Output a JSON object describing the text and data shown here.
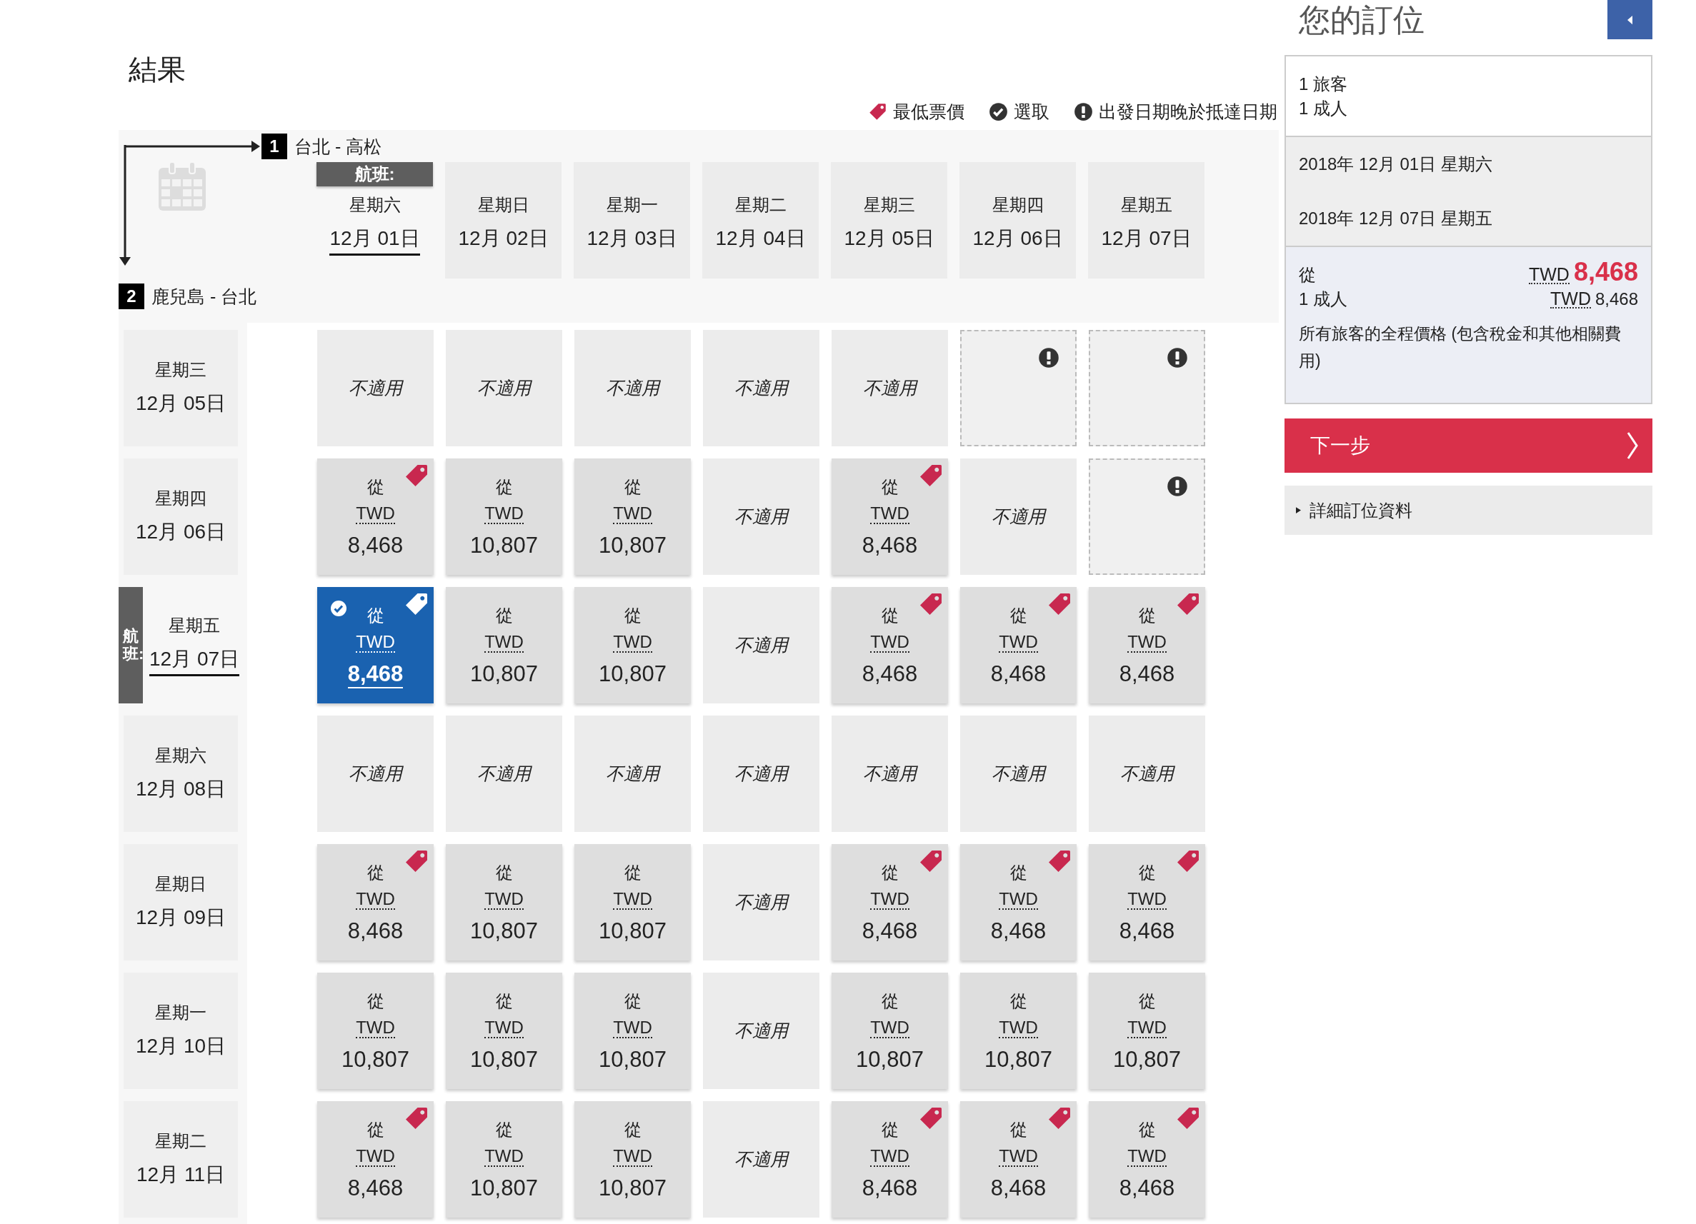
{
  "title": "結果",
  "legend": [
    {
      "kind": "lowest",
      "label": "最低票價"
    },
    {
      "kind": "selected",
      "label": "選取"
    },
    {
      "kind": "later",
      "label": "出發日期晚於抵達日期"
    }
  ],
  "routes": [
    {
      "number": "1",
      "label": "台北 - 高松"
    },
    {
      "number": "2",
      "label": "鹿兒島 - 台北"
    }
  ],
  "outbound_marker": "航班:",
  "return_marker": "航班:",
  "outbound_dates": [
    {
      "weekday": "星期六",
      "date": "12月 01日",
      "selected": true
    },
    {
      "weekday": "星期日",
      "date": "12月 02日",
      "selected": false
    },
    {
      "weekday": "星期一",
      "date": "12月 03日",
      "selected": false
    },
    {
      "weekday": "星期二",
      "date": "12月 04日",
      "selected": false
    },
    {
      "weekday": "星期三",
      "date": "12月 05日",
      "selected": false
    },
    {
      "weekday": "星期四",
      "date": "12月 06日",
      "selected": false
    },
    {
      "weekday": "星期五",
      "date": "12月 07日",
      "selected": false
    }
  ],
  "return_rows": [
    {
      "weekday": "星期三",
      "date": "12月 05日",
      "selected": false,
      "cells": [
        {
          "kind": "na",
          "text": "不適用"
        },
        {
          "kind": "na",
          "text": "不適用"
        },
        {
          "kind": "na",
          "text": "不適用"
        },
        {
          "kind": "na",
          "text": "不適用"
        },
        {
          "kind": "na",
          "text": "不適用"
        },
        {
          "kind": "later"
        },
        {
          "kind": "later"
        }
      ]
    },
    {
      "weekday": "星期四",
      "date": "12月 06日",
      "selected": false,
      "cells": [
        {
          "kind": "fare",
          "from": "從",
          "currency": "TWD",
          "amount": "8,468",
          "lowest": true,
          "selected": false
        },
        {
          "kind": "fare",
          "from": "從",
          "currency": "TWD",
          "amount": "10,807",
          "lowest": false,
          "selected": false
        },
        {
          "kind": "fare",
          "from": "從",
          "currency": "TWD",
          "amount": "10,807",
          "lowest": false,
          "selected": false
        },
        {
          "kind": "na",
          "text": "不適用"
        },
        {
          "kind": "fare",
          "from": "從",
          "currency": "TWD",
          "amount": "8,468",
          "lowest": true,
          "selected": false
        },
        {
          "kind": "na",
          "text": "不適用"
        },
        {
          "kind": "later"
        }
      ]
    },
    {
      "weekday": "星期五",
      "date": "12月 07日",
      "selected": true,
      "cells": [
        {
          "kind": "fare",
          "from": "從",
          "currency": "TWD",
          "amount": "8,468",
          "lowest": true,
          "selected": true
        },
        {
          "kind": "fare",
          "from": "從",
          "currency": "TWD",
          "amount": "10,807",
          "lowest": false,
          "selected": false
        },
        {
          "kind": "fare",
          "from": "從",
          "currency": "TWD",
          "amount": "10,807",
          "lowest": false,
          "selected": false
        },
        {
          "kind": "na",
          "text": "不適用"
        },
        {
          "kind": "fare",
          "from": "從",
          "currency": "TWD",
          "amount": "8,468",
          "lowest": true,
          "selected": false
        },
        {
          "kind": "fare",
          "from": "從",
          "currency": "TWD",
          "amount": "8,468",
          "lowest": true,
          "selected": false
        },
        {
          "kind": "fare",
          "from": "從",
          "currency": "TWD",
          "amount": "8,468",
          "lowest": true,
          "selected": false
        }
      ]
    },
    {
      "weekday": "星期六",
      "date": "12月 08日",
      "selected": false,
      "cells": [
        {
          "kind": "na",
          "text": "不適用"
        },
        {
          "kind": "na",
          "text": "不適用"
        },
        {
          "kind": "na",
          "text": "不適用"
        },
        {
          "kind": "na",
          "text": "不適用"
        },
        {
          "kind": "na",
          "text": "不適用"
        },
        {
          "kind": "na",
          "text": "不適用"
        },
        {
          "kind": "na",
          "text": "不適用"
        }
      ]
    },
    {
      "weekday": "星期日",
      "date": "12月 09日",
      "selected": false,
      "cells": [
        {
          "kind": "fare",
          "from": "從",
          "currency": "TWD",
          "amount": "8,468",
          "lowest": true,
          "selected": false
        },
        {
          "kind": "fare",
          "from": "從",
          "currency": "TWD",
          "amount": "10,807",
          "lowest": false,
          "selected": false
        },
        {
          "kind": "fare",
          "from": "從",
          "currency": "TWD",
          "amount": "10,807",
          "lowest": false,
          "selected": false
        },
        {
          "kind": "na",
          "text": "不適用"
        },
        {
          "kind": "fare",
          "from": "從",
          "currency": "TWD",
          "amount": "8,468",
          "lowest": true,
          "selected": false
        },
        {
          "kind": "fare",
          "from": "從",
          "currency": "TWD",
          "amount": "8,468",
          "lowest": true,
          "selected": false
        },
        {
          "kind": "fare",
          "from": "從",
          "currency": "TWD",
          "amount": "8,468",
          "lowest": true,
          "selected": false
        }
      ]
    },
    {
      "weekday": "星期一",
      "date": "12月 10日",
      "selected": false,
      "cells": [
        {
          "kind": "fare",
          "from": "從",
          "currency": "TWD",
          "amount": "10,807",
          "lowest": false,
          "selected": false
        },
        {
          "kind": "fare",
          "from": "從",
          "currency": "TWD",
          "amount": "10,807",
          "lowest": false,
          "selected": false
        },
        {
          "kind": "fare",
          "from": "從",
          "currency": "TWD",
          "amount": "10,807",
          "lowest": false,
          "selected": false
        },
        {
          "kind": "na",
          "text": "不適用"
        },
        {
          "kind": "fare",
          "from": "從",
          "currency": "TWD",
          "amount": "10,807",
          "lowest": false,
          "selected": false
        },
        {
          "kind": "fare",
          "from": "從",
          "currency": "TWD",
          "amount": "10,807",
          "lowest": false,
          "selected": false
        },
        {
          "kind": "fare",
          "from": "從",
          "currency": "TWD",
          "amount": "10,807",
          "lowest": false,
          "selected": false
        }
      ]
    },
    {
      "weekday": "星期二",
      "date": "12月 11日",
      "selected": false,
      "cells": [
        {
          "kind": "fare",
          "from": "從",
          "currency": "TWD",
          "amount": "8,468",
          "lowest": true,
          "selected": false
        },
        {
          "kind": "fare",
          "from": "從",
          "currency": "TWD",
          "amount": "10,807",
          "lowest": false,
          "selected": false
        },
        {
          "kind": "fare",
          "from": "從",
          "currency": "TWD",
          "amount": "10,807",
          "lowest": false,
          "selected": false
        },
        {
          "kind": "na",
          "text": "不適用"
        },
        {
          "kind": "fare",
          "from": "從",
          "currency": "TWD",
          "amount": "8,468",
          "lowest": true,
          "selected": false
        },
        {
          "kind": "fare",
          "from": "從",
          "currency": "TWD",
          "amount": "8,468",
          "lowest": true,
          "selected": false
        },
        {
          "kind": "fare",
          "from": "從",
          "currency": "TWD",
          "amount": "8,468",
          "lowest": true,
          "selected": false
        }
      ]
    }
  ],
  "booking": {
    "title": "您的訂位",
    "passengers": [
      "1 旅客",
      "1 成人"
    ],
    "dates": [
      "2018年 12月 01日 星期六",
      "2018年 12月 07日 星期五"
    ],
    "total": {
      "from": "從",
      "currency": "TWD",
      "amount": "8,468"
    },
    "line": {
      "label": "1 成人",
      "currency": "TWD",
      "amount": "8,468"
    },
    "note": "所有旅客的全程價格 (包含稅金和其他相關費用)",
    "next": "下一步",
    "details": "詳細訂位資料"
  }
}
